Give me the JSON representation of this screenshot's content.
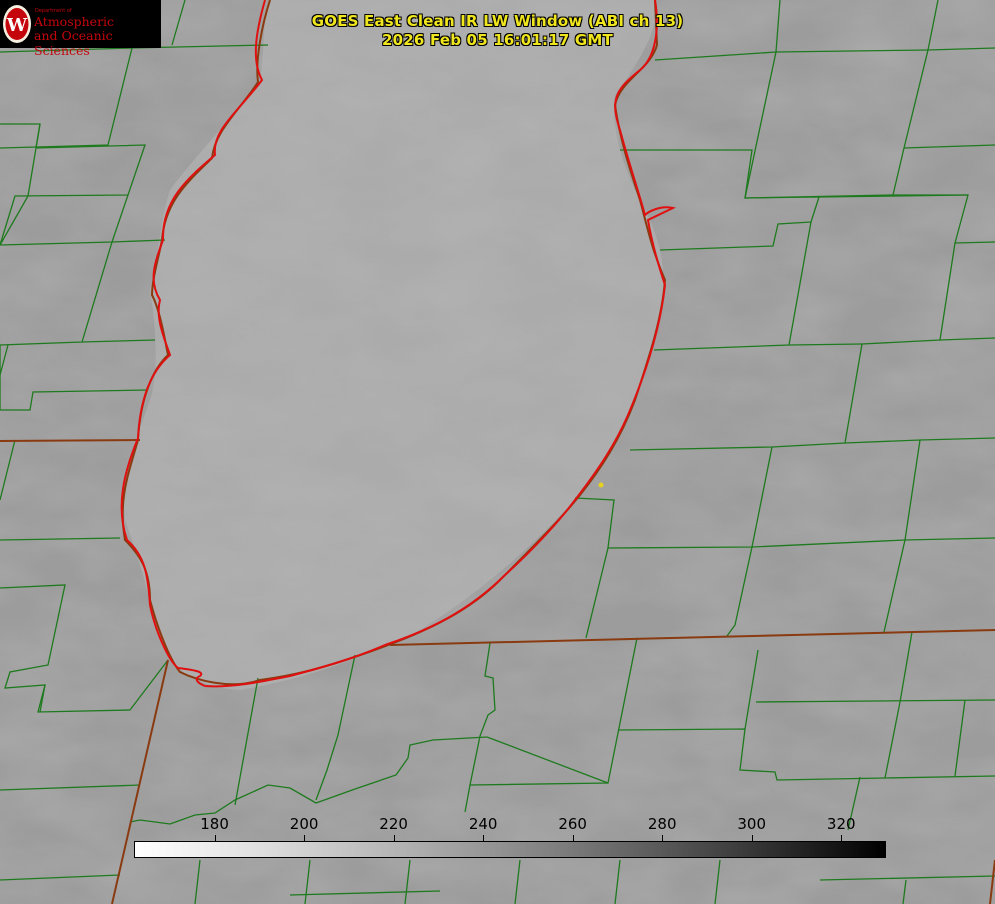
{
  "title": {
    "line1": "GOES East Clean IR LW Window (ABI ch 13)",
    "line2": "2026 Feb 05 16:01:17 GMT"
  },
  "logo": {
    "dept": "Department of",
    "line1": "Atmospheric",
    "line2": "and Oceanic Sciences",
    "letter": "W"
  },
  "colorbar": {
    "ticks": [
      "180",
      "200",
      "220",
      "240",
      "260",
      "280",
      "300",
      "320"
    ],
    "tick_values": [
      180,
      200,
      220,
      240,
      260,
      280,
      300,
      320
    ],
    "range": [
      162,
      330
    ],
    "colormap": "white-to-black"
  },
  "colors": {
    "background": "#9a9a9a",
    "county_lines": "#1e7a1e",
    "lake_outline": "#e01010",
    "state_lines": "#8a3a10",
    "title_text": "#f0e61e",
    "marker": "#e6d21e",
    "logo_red": "#c5050c"
  }
}
